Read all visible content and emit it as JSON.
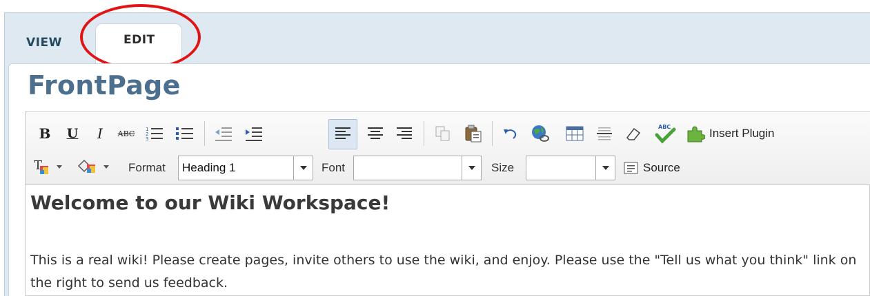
{
  "tabs": {
    "view_label": "VIEW",
    "edit_label": "EDIT"
  },
  "page": {
    "title": "FrontPage"
  },
  "toolbar": {
    "bold_glyph": "B",
    "underline_glyph": "U",
    "italic_glyph": "I",
    "strike_glyph": "ABC",
    "spell_glyph": "ABC",
    "insert_plugin_label": "Insert Plugin",
    "format_label": "Format",
    "format_value": "Heading 1",
    "font_label": "Font",
    "font_value": "",
    "size_label": "Size",
    "size_value": "",
    "source_label": "Source"
  },
  "document": {
    "heading": "Welcome to our Wiki Workspace!",
    "paragraph": "This is a real wiki!  Please create pages, invite others to use the wiki, and enjoy.  Please use the \"Tell us what you think\" link on the right to send us feedback."
  },
  "colors": {
    "title_blue": "#4b6f8d",
    "tab_bar": "#dfe9f2",
    "highlight_ring": "#e01414"
  }
}
